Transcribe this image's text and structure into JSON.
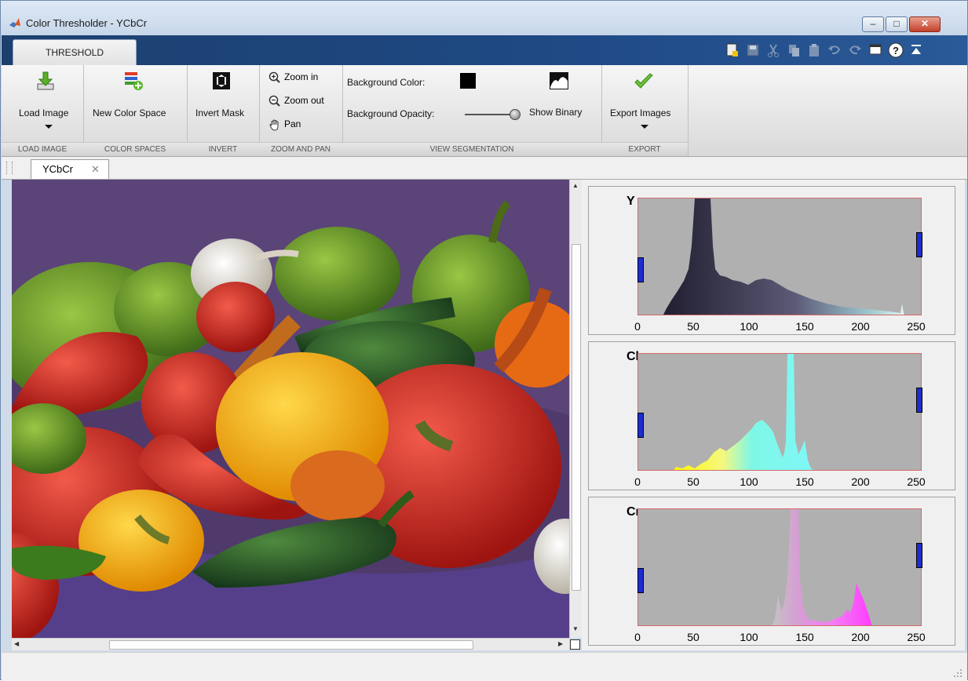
{
  "window": {
    "title": "Color Thresholder - YCbCr",
    "min_glyph": "–",
    "max_glyph": "□",
    "close_glyph": "✕"
  },
  "ribbon": {
    "tab": "THRESHOLD"
  },
  "toolstrip": {
    "load_image": {
      "label": "Load Image",
      "section": "LOAD IMAGE"
    },
    "new_color_space": {
      "label": "New Color Space",
      "section": "COLOR SPACES"
    },
    "invert_mask": {
      "label": "Invert Mask",
      "section": "INVERT"
    },
    "zoom": {
      "zoom_in": "Zoom in",
      "zoom_out": "Zoom out",
      "pan": "Pan",
      "section": "ZOOM AND PAN"
    },
    "view": {
      "background_color_label": "Background Color:",
      "background_color": "#000000",
      "background_opacity_label": "Background Opacity:",
      "background_opacity": 1.0,
      "show_binary": "Show Binary",
      "section": "VIEW SEGMENTATION"
    },
    "export": {
      "label": "Export Images",
      "section": "EXPORT"
    }
  },
  "document": {
    "tab": "YCbCr",
    "close_glyph": "✕"
  },
  "histograms": {
    "ticks": [
      "0",
      "50",
      "100",
      "150",
      "200",
      "250"
    ],
    "channels": [
      {
        "name": "Y",
        "range": [
          0,
          255
        ]
      },
      {
        "name": "Cb",
        "range": [
          0,
          255
        ]
      },
      {
        "name": "Cr",
        "range": [
          0,
          255
        ]
      }
    ]
  },
  "colors": {
    "accent_blue": "#1f4a85",
    "marker": "#1d2dd2",
    "plot_bg": "#b0b0b0"
  }
}
